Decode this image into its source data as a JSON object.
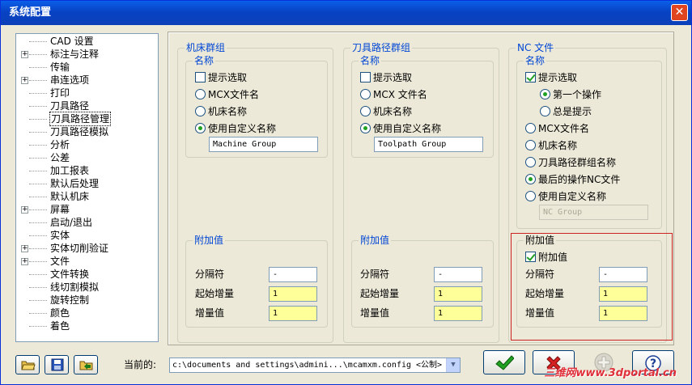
{
  "window": {
    "title": "系统配置",
    "close": "✕"
  },
  "tree": [
    {
      "label": "CAD 设置",
      "expandable": false,
      "selected": false
    },
    {
      "label": "标注与注释",
      "expandable": true,
      "selected": false
    },
    {
      "label": "传输",
      "expandable": false,
      "selected": false
    },
    {
      "label": "串连选项",
      "expandable": true,
      "selected": false
    },
    {
      "label": "打印",
      "expandable": false,
      "selected": false
    },
    {
      "label": "刀具路径",
      "expandable": false,
      "selected": false
    },
    {
      "label": "刀具路径管理",
      "expandable": false,
      "selected": true
    },
    {
      "label": "刀具路径模拟",
      "expandable": false,
      "selected": false
    },
    {
      "label": "分析",
      "expandable": false,
      "selected": false
    },
    {
      "label": "公差",
      "expandable": false,
      "selected": false
    },
    {
      "label": "加工报表",
      "expandable": false,
      "selected": false
    },
    {
      "label": "默认后处理",
      "expandable": false,
      "selected": false
    },
    {
      "label": "默认机床",
      "expandable": false,
      "selected": false
    },
    {
      "label": "屏幕",
      "expandable": true,
      "selected": false
    },
    {
      "label": "启动/退出",
      "expandable": false,
      "selected": false
    },
    {
      "label": "实体",
      "expandable": false,
      "selected": false
    },
    {
      "label": "实体切削验证",
      "expandable": true,
      "selected": false
    },
    {
      "label": "文件",
      "expandable": true,
      "selected": false
    },
    {
      "label": "文件转换",
      "expandable": false,
      "selected": false
    },
    {
      "label": "线切割模拟",
      "expandable": false,
      "selected": false
    },
    {
      "label": "旋转控制",
      "expandable": false,
      "selected": false
    },
    {
      "label": "颜色",
      "expandable": false,
      "selected": false
    },
    {
      "label": "着色",
      "expandable": false,
      "selected": false
    }
  ],
  "machine_group": {
    "title": "机床群组",
    "name_title": "名称",
    "prompt": "提示选取",
    "opt_mcx": "MCX文件名",
    "opt_machine": "机床名称",
    "opt_custom": "使用自定义名称",
    "custom_value": "Machine Group",
    "suffix_title": "附加值",
    "sep_label": "分隔符",
    "sep_value": "-",
    "start_label": "起始增量",
    "start_value": "1",
    "inc_label": "增量值",
    "inc_value": "1"
  },
  "toolpath_group": {
    "title": "刀具路径群组",
    "name_title": "名称",
    "prompt": "提示选取",
    "opt_mcx": "MCX 文件名",
    "opt_machine": "机床名称",
    "opt_custom": "使用自定义名称",
    "custom_value": "Toolpath Group",
    "suffix_title": "附加值",
    "sep_label": "分隔符",
    "sep_value": "-",
    "start_label": "起始增量",
    "start_value": "1",
    "inc_label": "增量值",
    "inc_value": "1"
  },
  "nc_file": {
    "title": "NC 文件",
    "name_title": "名称",
    "prompt": "提示选取",
    "opt_first": "第一个操作",
    "opt_always": "总是提示",
    "opt_mcx": "MCX文件名",
    "opt_machine": "机床名称",
    "opt_tpgroup": "刀具路径群组名称",
    "opt_lastnc": "最后的操作NC文件",
    "opt_custom": "使用自定义名称",
    "custom_value": "NC Group",
    "suffix_title": "附加值",
    "suffix_check": "附加值",
    "sep_label": "分隔符",
    "sep_value": "-",
    "start_label": "起始增量",
    "start_value": "1",
    "inc_label": "增量值",
    "inc_value": "1"
  },
  "bottom": {
    "current_label": "当前的:",
    "path_value": "c:\\documents and settings\\admini...\\mcamxm.config <公制>",
    "dropdown_arrow": "▼"
  },
  "colors": {
    "title_bar": "#0a4fd8",
    "group_title": "#0046d5",
    "yellow_field": "#ffff99",
    "highlight": "#cc2222",
    "ok_green": "#21a121",
    "cancel_red": "#d42020"
  },
  "watermark": "三维网www.3dportal.cn"
}
